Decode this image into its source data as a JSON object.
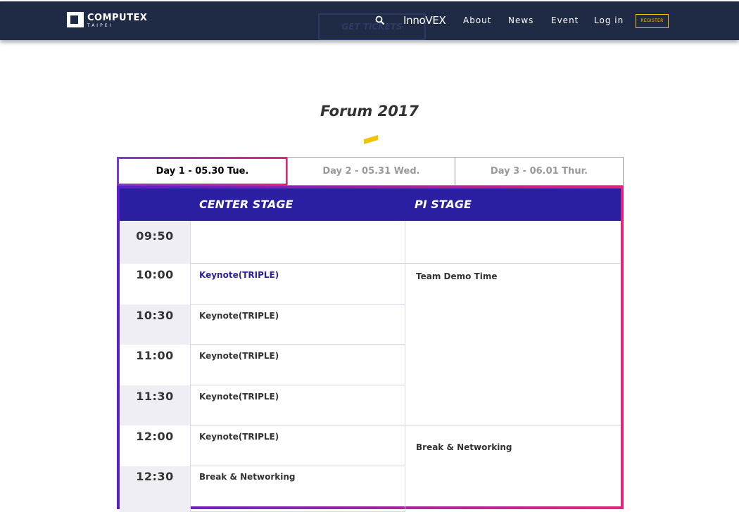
{
  "header": {
    "logo_text": "COMPUTEX",
    "logo_sub": "TAIPEI",
    "ghost_button": "GET TICKETS",
    "innovex": "InnoVEX",
    "nav": [
      "About",
      "News",
      "Event",
      "Log in"
    ],
    "register": "REGISTER",
    "colors": {
      "background": "#1f2a44",
      "accent": "#f4c400"
    }
  },
  "page": {
    "title": "Forum 2017",
    "accent_color": "#f4c400"
  },
  "tabs": [
    {
      "label": "Day 1 - 05.30 Tue.",
      "active": true
    },
    {
      "label": "Day 2 - 05.31 Wed.",
      "active": false
    },
    {
      "label": "Day 3 - 06.01 Thur.",
      "active": false
    }
  ],
  "schedule": {
    "stages": [
      "CENTER STAGE",
      "PI STAGE"
    ],
    "times": [
      "09:50",
      "10:00",
      "10:30",
      "11:00",
      "11:30",
      "12:00",
      "12:30"
    ],
    "center_sessions": [
      "",
      "Keynote(TRIPLE)",
      "Keynote(TRIPLE)",
      "Keynote(TRIPLE)",
      "Keynote(TRIPLE)",
      "Keynote(TRIPLE)",
      "Break & Networking"
    ],
    "pi_sessions": [
      "",
      "Team Demo Time",
      "Break & Networking"
    ],
    "colors": {
      "header": "#2a1fa0",
      "gradient_start": "#5a1fc9",
      "gradient_end": "#e0267a"
    }
  }
}
